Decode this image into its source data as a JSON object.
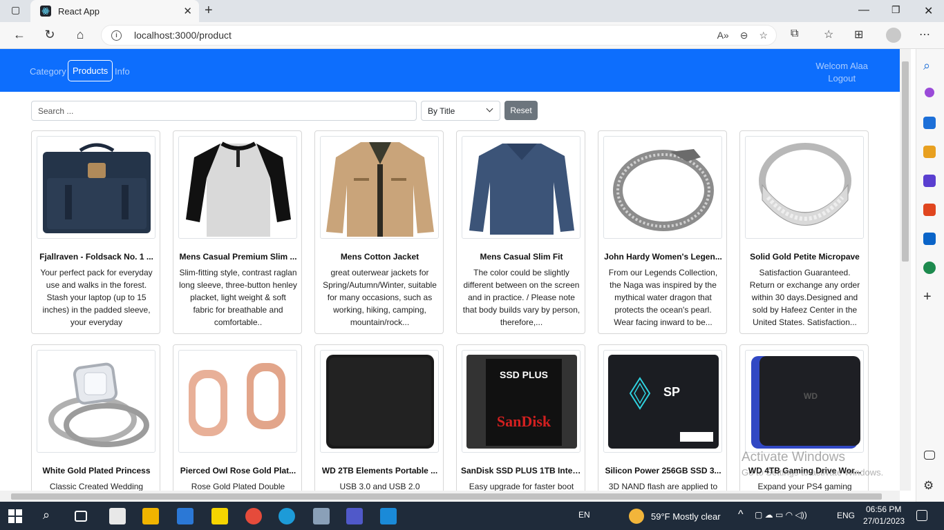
{
  "browser": {
    "tab_title": "React App",
    "url": "localhost:3000/product"
  },
  "nav": {
    "links": [
      "Category",
      "Products",
      "Info"
    ],
    "welcome": "Welcom Alaa",
    "logout": "Logout"
  },
  "search": {
    "placeholder": "Search ...",
    "sort_value": "By Title",
    "reset_label": "Reset"
  },
  "products": [
    {
      "title": "Fjallraven - Foldsack No. 1 ...",
      "description": "Your perfect pack for everyday use and walks in the forest. Stash your laptop (up to 15 inches) in the padded sleeve, your everyday",
      "image": "backpack"
    },
    {
      "title": "Mens Casual Premium Slim ...",
      "description": "Slim-fitting style, contrast raglan long sleeve, three-button henley placket, light weight & soft fabric for breathable and comfortable..",
      "image": "raglan-shirt"
    },
    {
      "title": "Mens Cotton Jacket",
      "description": "great outerwear jackets for Spring/Autumn/Winter, suitable for many occasions, such as working, hiking, camping, mountain/rock...",
      "image": "jacket"
    },
    {
      "title": "Mens Casual Slim Fit",
      "description": "The color could be slightly different between on the screen and in practice. / Please note that body builds vary by person, therefore,...",
      "image": "blue-shirt"
    },
    {
      "title": "John Hardy Women's Legen...",
      "description": "From our Legends Collection, the Naga was inspired by the mythical water dragon that protects the ocean's pearl. Wear facing inward to be...",
      "image": "bracelet"
    },
    {
      "title": "Solid Gold Petite Micropave",
      "description": "Satisfaction Guaranteed. Return or exchange any order within 30 days.Designed and sold by Hafeez Center in the United States. Satisfaction...",
      "image": "ring"
    },
    {
      "title": "White Gold Plated Princess",
      "description": "Classic Created Wedding",
      "image": "diamond-ring"
    },
    {
      "title": "Pierced Owl Rose Gold Plat...",
      "description": "Rose Gold Plated Double",
      "image": "rose-gold-plugs"
    },
    {
      "title": "WD 2TB Elements Portable ...",
      "description": "USB 3.0 and USB 2.0",
      "image": "hdd"
    },
    {
      "title": "SanDisk SSD PLUS 1TB Inter...",
      "description": "Easy upgrade for faster boot",
      "image": "sandisk-ssd"
    },
    {
      "title": "Silicon Power 256GB SSD 3...",
      "description": "3D NAND flash are applied to",
      "image": "sp-ssd"
    },
    {
      "title": "WD 4TB Gaming Drive Wor...",
      "description": "Expand your PS4 gaming",
      "image": "wd-gaming"
    }
  ],
  "watermark": {
    "title": "Activate Windows",
    "subtitle": "Go to Settings to activate Windows."
  },
  "taskbar": {
    "lang": "EN",
    "weather": "59°F  Mostly clear",
    "input_lang": "ENG",
    "time": "06:56 PM",
    "date": "27/01/2023"
  }
}
